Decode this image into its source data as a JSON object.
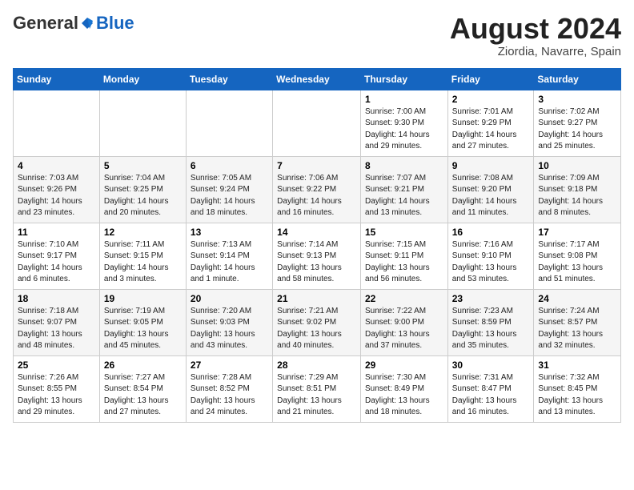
{
  "header": {
    "logo_general": "General",
    "logo_blue": "Blue",
    "month_title": "August 2024",
    "location": "Ziordia, Navarre, Spain"
  },
  "weekdays": [
    "Sunday",
    "Monday",
    "Tuesday",
    "Wednesday",
    "Thursday",
    "Friday",
    "Saturday"
  ],
  "weeks": [
    [
      {
        "day": "",
        "info": ""
      },
      {
        "day": "",
        "info": ""
      },
      {
        "day": "",
        "info": ""
      },
      {
        "day": "",
        "info": ""
      },
      {
        "day": "1",
        "info": "Sunrise: 7:00 AM\nSunset: 9:30 PM\nDaylight: 14 hours\nand 29 minutes."
      },
      {
        "day": "2",
        "info": "Sunrise: 7:01 AM\nSunset: 9:29 PM\nDaylight: 14 hours\nand 27 minutes."
      },
      {
        "day": "3",
        "info": "Sunrise: 7:02 AM\nSunset: 9:27 PM\nDaylight: 14 hours\nand 25 minutes."
      }
    ],
    [
      {
        "day": "4",
        "info": "Sunrise: 7:03 AM\nSunset: 9:26 PM\nDaylight: 14 hours\nand 23 minutes."
      },
      {
        "day": "5",
        "info": "Sunrise: 7:04 AM\nSunset: 9:25 PM\nDaylight: 14 hours\nand 20 minutes."
      },
      {
        "day": "6",
        "info": "Sunrise: 7:05 AM\nSunset: 9:24 PM\nDaylight: 14 hours\nand 18 minutes."
      },
      {
        "day": "7",
        "info": "Sunrise: 7:06 AM\nSunset: 9:22 PM\nDaylight: 14 hours\nand 16 minutes."
      },
      {
        "day": "8",
        "info": "Sunrise: 7:07 AM\nSunset: 9:21 PM\nDaylight: 14 hours\nand 13 minutes."
      },
      {
        "day": "9",
        "info": "Sunrise: 7:08 AM\nSunset: 9:20 PM\nDaylight: 14 hours\nand 11 minutes."
      },
      {
        "day": "10",
        "info": "Sunrise: 7:09 AM\nSunset: 9:18 PM\nDaylight: 14 hours\nand 8 minutes."
      }
    ],
    [
      {
        "day": "11",
        "info": "Sunrise: 7:10 AM\nSunset: 9:17 PM\nDaylight: 14 hours\nand 6 minutes."
      },
      {
        "day": "12",
        "info": "Sunrise: 7:11 AM\nSunset: 9:15 PM\nDaylight: 14 hours\nand 3 minutes."
      },
      {
        "day": "13",
        "info": "Sunrise: 7:13 AM\nSunset: 9:14 PM\nDaylight: 14 hours\nand 1 minute."
      },
      {
        "day": "14",
        "info": "Sunrise: 7:14 AM\nSunset: 9:13 PM\nDaylight: 13 hours\nand 58 minutes."
      },
      {
        "day": "15",
        "info": "Sunrise: 7:15 AM\nSunset: 9:11 PM\nDaylight: 13 hours\nand 56 minutes."
      },
      {
        "day": "16",
        "info": "Sunrise: 7:16 AM\nSunset: 9:10 PM\nDaylight: 13 hours\nand 53 minutes."
      },
      {
        "day": "17",
        "info": "Sunrise: 7:17 AM\nSunset: 9:08 PM\nDaylight: 13 hours\nand 51 minutes."
      }
    ],
    [
      {
        "day": "18",
        "info": "Sunrise: 7:18 AM\nSunset: 9:07 PM\nDaylight: 13 hours\nand 48 minutes."
      },
      {
        "day": "19",
        "info": "Sunrise: 7:19 AM\nSunset: 9:05 PM\nDaylight: 13 hours\nand 45 minutes."
      },
      {
        "day": "20",
        "info": "Sunrise: 7:20 AM\nSunset: 9:03 PM\nDaylight: 13 hours\nand 43 minutes."
      },
      {
        "day": "21",
        "info": "Sunrise: 7:21 AM\nSunset: 9:02 PM\nDaylight: 13 hours\nand 40 minutes."
      },
      {
        "day": "22",
        "info": "Sunrise: 7:22 AM\nSunset: 9:00 PM\nDaylight: 13 hours\nand 37 minutes."
      },
      {
        "day": "23",
        "info": "Sunrise: 7:23 AM\nSunset: 8:59 PM\nDaylight: 13 hours\nand 35 minutes."
      },
      {
        "day": "24",
        "info": "Sunrise: 7:24 AM\nSunset: 8:57 PM\nDaylight: 13 hours\nand 32 minutes."
      }
    ],
    [
      {
        "day": "25",
        "info": "Sunrise: 7:26 AM\nSunset: 8:55 PM\nDaylight: 13 hours\nand 29 minutes."
      },
      {
        "day": "26",
        "info": "Sunrise: 7:27 AM\nSunset: 8:54 PM\nDaylight: 13 hours\nand 27 minutes."
      },
      {
        "day": "27",
        "info": "Sunrise: 7:28 AM\nSunset: 8:52 PM\nDaylight: 13 hours\nand 24 minutes."
      },
      {
        "day": "28",
        "info": "Sunrise: 7:29 AM\nSunset: 8:51 PM\nDaylight: 13 hours\nand 21 minutes."
      },
      {
        "day": "29",
        "info": "Sunrise: 7:30 AM\nSunset: 8:49 PM\nDaylight: 13 hours\nand 18 minutes."
      },
      {
        "day": "30",
        "info": "Sunrise: 7:31 AM\nSunset: 8:47 PM\nDaylight: 13 hours\nand 16 minutes."
      },
      {
        "day": "31",
        "info": "Sunrise: 7:32 AM\nSunset: 8:45 PM\nDaylight: 13 hours\nand 13 minutes."
      }
    ]
  ]
}
